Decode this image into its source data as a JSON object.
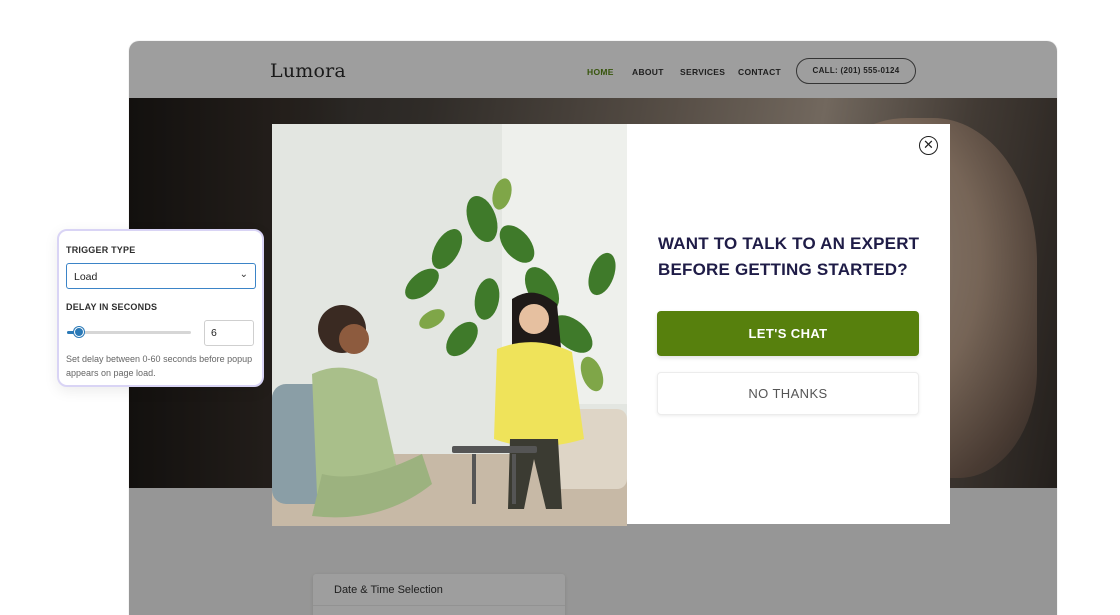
{
  "site": {
    "logo": "Lumora",
    "nav": [
      "HOME",
      "ABOUT",
      "SERVICES",
      "CONTACT"
    ],
    "call_label": "CALL: (201) 555-0124",
    "accent_color": "#5a8a14",
    "date_time_title": "Date & Time Selection"
  },
  "popup": {
    "heading": "WANT TO TALK TO AN EXPERT BEFORE GETTING STARTED?",
    "primary_label": "LET'S CHAT",
    "secondary_label": "NO THANKS",
    "primary_color": "#57800d",
    "heading_color": "#1f1c47",
    "close_icon": "close-icon"
  },
  "settings": {
    "trigger_type_label": "TRIGGER TYPE",
    "trigger_type_value": "Load",
    "delay_label": "DELAY IN SECONDS",
    "delay_value": "6",
    "delay_fraction": 0.1,
    "help_text": "Set delay between 0-60 seconds before popup appears on page load."
  }
}
